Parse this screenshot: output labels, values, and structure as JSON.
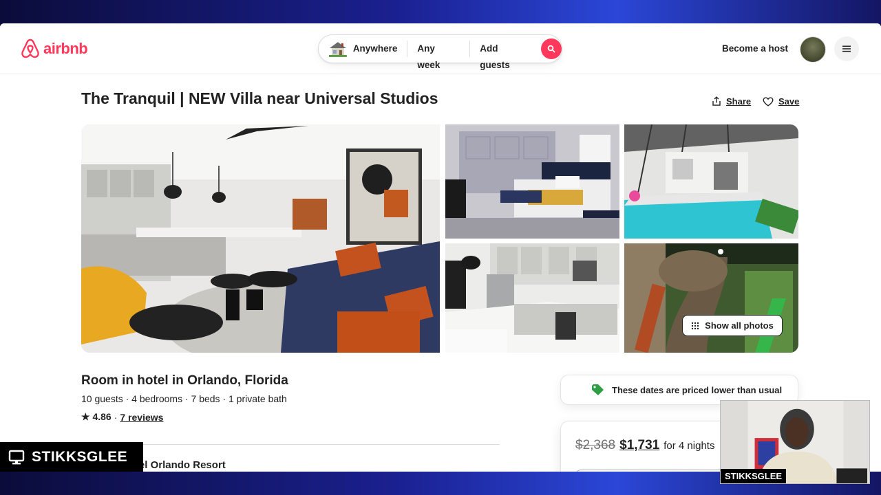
{
  "header": {
    "logo_text": "airbnb",
    "search": {
      "location": "Anywhere",
      "dates": "Any week",
      "guests": "Add guests"
    },
    "become_host": "Become a host"
  },
  "listing": {
    "title": "The Tranquil | NEW Villa near Universal Studios",
    "share_label": "Share",
    "save_label": "Save",
    "show_all_photos": "Show all photos",
    "room_title": "Room in hotel in Orlando, Florida",
    "details": "10 guests · 4 bedrooms · 7 beds · 1 private bath",
    "rating": "★ 4.86",
    "separator": "·",
    "reviews": "7 reviews",
    "hosted_by": "Hosted by Villatel Orlando Resort",
    "hosted_by_visible": "ted by Villatel Orlando Resort"
  },
  "pricing": {
    "note": "These dates are priced lower than usual",
    "old_price": "$2,368",
    "new_price": "$1,731",
    "per_nights": "for 4 nights"
  },
  "overlay": {
    "streamer_name": "STIKKSGLEE",
    "webcam_label": "STIKKSGLEE"
  },
  "colors": {
    "brand": "#ff385c",
    "text": "#222222",
    "muted": "#717171",
    "note_tag": "#2e9e44"
  }
}
